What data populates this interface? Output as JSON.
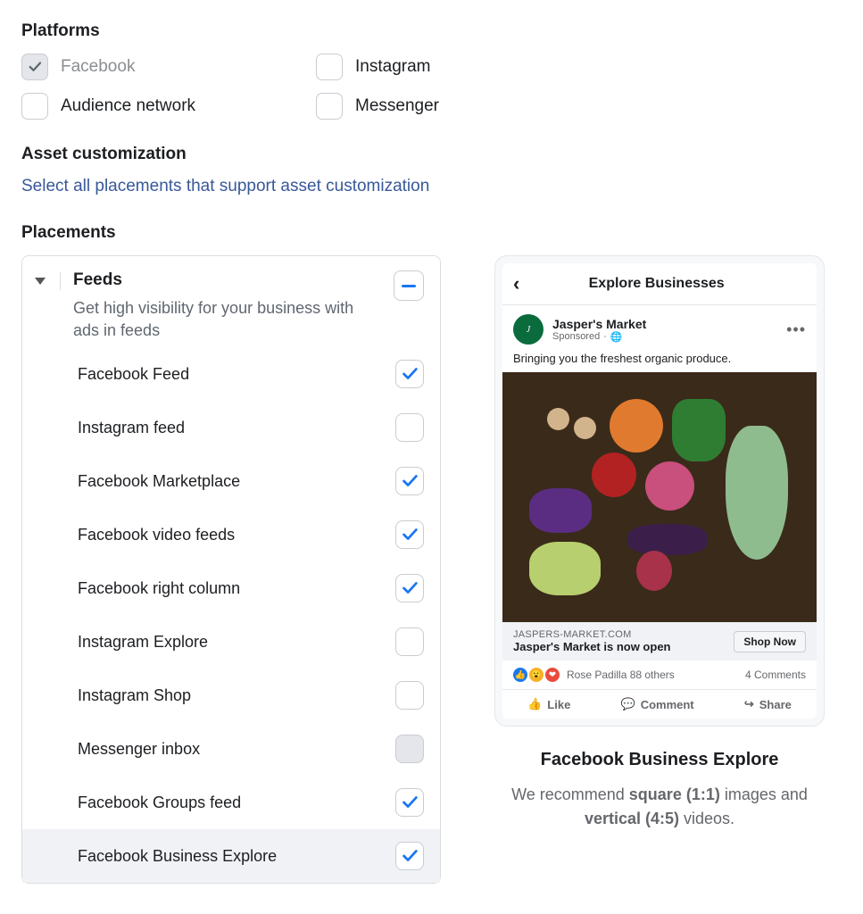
{
  "sections": {
    "platforms_title": "Platforms",
    "asset_custom_title": "Asset customization",
    "asset_custom_link": "Select all placements that support asset customization",
    "placements_title": "Placements"
  },
  "platforms": [
    {
      "label": "Facebook",
      "checked": true,
      "disabled": true
    },
    {
      "label": "Instagram",
      "checked": false,
      "disabled": false
    },
    {
      "label": "Audience network",
      "checked": false,
      "disabled": false
    },
    {
      "label": "Messenger",
      "checked": false,
      "disabled": false
    }
  ],
  "feeds_group": {
    "title": "Feeds",
    "description": "Get high visibility for your business with ads in feeds",
    "state": "indeterminate"
  },
  "placements": [
    {
      "label": "Facebook Feed",
      "checked": true,
      "disabled": false,
      "highlighted": false
    },
    {
      "label": "Instagram feed",
      "checked": false,
      "disabled": false,
      "highlighted": false
    },
    {
      "label": "Facebook Marketplace",
      "checked": true,
      "disabled": false,
      "highlighted": false
    },
    {
      "label": "Facebook video feeds",
      "checked": true,
      "disabled": false,
      "highlighted": false
    },
    {
      "label": "Facebook right column",
      "checked": true,
      "disabled": false,
      "highlighted": false
    },
    {
      "label": "Instagram Explore",
      "checked": false,
      "disabled": false,
      "highlighted": false
    },
    {
      "label": "Instagram Shop",
      "checked": false,
      "disabled": false,
      "highlighted": false
    },
    {
      "label": "Messenger inbox",
      "checked": false,
      "disabled": true,
      "highlighted": false
    },
    {
      "label": "Facebook Groups feed",
      "checked": true,
      "disabled": false,
      "highlighted": false
    },
    {
      "label": "Facebook Business Explore",
      "checked": true,
      "disabled": false,
      "highlighted": true
    }
  ],
  "preview": {
    "screen_title": "Explore Businesses",
    "page_name": "Jasper's Market",
    "sponsored_label": "Sponsored",
    "caption": "Bringing you the freshest organic produce.",
    "link_domain": "JASPERS-MARKET.COM",
    "link_title": "Jasper's Market is now open",
    "cta": "Shop Now",
    "reactions_text": "Rose Padilla 88 others",
    "comments_text": "4 Comments",
    "actions": {
      "like": "Like",
      "comment": "Comment",
      "share": "Share"
    },
    "panel_title": "Facebook Business Explore",
    "recommend_prefix": "We recommend ",
    "square": "square (1:1)",
    "mid": " images and ",
    "vertical": "vertical (4:5)",
    "suffix": " videos."
  },
  "colors": {
    "link": "#385898",
    "accent": "#1877f2"
  }
}
